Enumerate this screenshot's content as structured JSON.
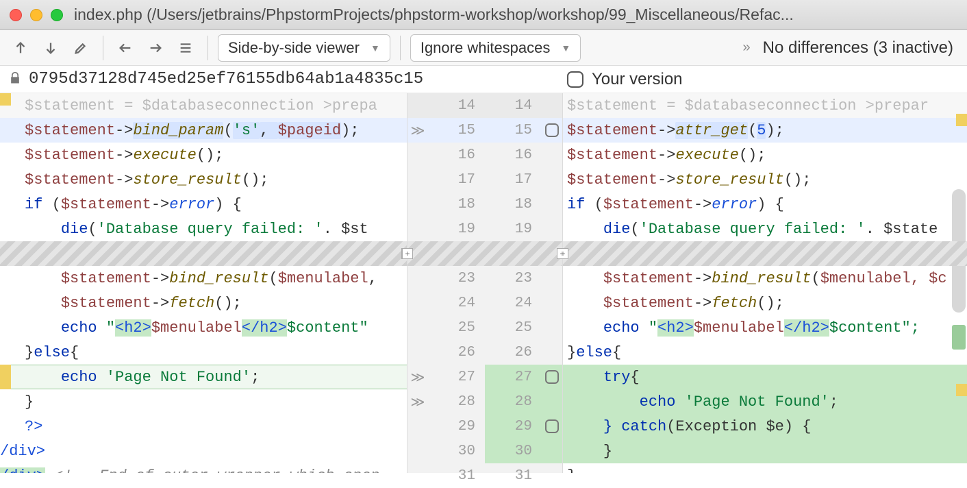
{
  "title": "index.php (/Users/jetbrains/PhpstormProjects/phpstorm-workshop/workshop/99_Miscellaneous/Refac...",
  "toolbar": {
    "dropdown1": "Side-by-side viewer",
    "dropdown2": "Ignore whitespaces",
    "status": "No differences (3 inactive)"
  },
  "header": {
    "hash": "0795d37128d745ed25ef76155db64ab1a4835c15",
    "right_label": "Your version"
  },
  "gutter": {
    "rows": [
      {
        "l": "14",
        "r": "14",
        "mark": "",
        "check": false,
        "bg": "faded"
      },
      {
        "l": "15",
        "r": "15",
        "mark": "≫",
        "check": true,
        "bg": "blue"
      },
      {
        "l": "16",
        "r": "16",
        "mark": "",
        "check": false,
        "bg": ""
      },
      {
        "l": "17",
        "r": "17",
        "mark": "",
        "check": false,
        "bg": ""
      },
      {
        "l": "18",
        "r": "18",
        "mark": "",
        "check": false,
        "bg": ""
      },
      {
        "l": "19",
        "r": "19",
        "mark": "",
        "check": false,
        "bg": ""
      },
      {
        "l": "fold",
        "r": "fold",
        "mark": "",
        "check": false,
        "bg": ""
      },
      {
        "l": "23",
        "r": "23",
        "mark": "",
        "check": false,
        "bg": ""
      },
      {
        "l": "24",
        "r": "24",
        "mark": "",
        "check": false,
        "bg": ""
      },
      {
        "l": "25",
        "r": "25",
        "mark": "",
        "check": false,
        "bg": ""
      },
      {
        "l": "26",
        "r": "26",
        "mark": "",
        "check": false,
        "bg": ""
      },
      {
        "l": "27",
        "r": "27",
        "mark": "≫",
        "check": true,
        "bg": "green"
      },
      {
        "l": "28",
        "r": "28",
        "mark": "≫",
        "check": false,
        "bg": "green"
      },
      {
        "l": "29",
        "r": "29",
        "mark": "",
        "check": true,
        "bg": "green"
      },
      {
        "l": "30",
        "r": "30",
        "mark": "",
        "check": false,
        "bg": "green"
      },
      {
        "l": "31",
        "r": "31",
        "mark": "",
        "check": false,
        "bg": ""
      }
    ]
  },
  "left_code": {
    "l14": "$statement = $databaseconnection >prepa",
    "l15_var": "$statement",
    "l15_method": "bind_param",
    "l15_arg1": "'s'",
    "l15_arg2": "$pageid",
    "l16_var": "$statement",
    "l16_method": "execute",
    "l17_var": "$statement",
    "l17_method": "store_result",
    "l18_kw": "if",
    "l18_var": "$statement",
    "l18_prop": "error",
    "l19_die": "die",
    "l19_str": "'Database query failed: '",
    "l19_tail": " . $st",
    "l23_var": "$statement",
    "l23_method": "bind_result",
    "l23_arg": "$menulabel",
    "l24_var": "$statement",
    "l24_method": "fetch",
    "l25_echo": "echo",
    "l25_q1": "\"",
    "l25_h2o": "<h2>",
    "l25_v": "$menulabel",
    "l25_h2c": "</h2>",
    "l25_rest": " $content\"",
    "l26": "} else {",
    "l27_echo": "echo",
    "l27_str": "'Page Not Found'",
    "l28": "}",
    "l29": "?>",
    "l30": "/div>",
    "l31_tag": "/div>",
    "l31_comment": "<!-- End of outer-wrapper which open"
  },
  "right_code": {
    "r14": "$statement = $databaseconnection >prepar",
    "r15_var": "$statement",
    "r15_method": "attr_get",
    "r15_arg": "5",
    "r16_var": "$statement",
    "r16_method": "execute",
    "r17_var": "$statement",
    "r17_method": "store_result",
    "r18_kw": "if",
    "r18_var": "$statement",
    "r18_prop": "error",
    "r19_die": "die",
    "r19_str": "'Database query failed: '",
    "r19_tail": " . $state",
    "r23_var": "$statement",
    "r23_method": "bind_result",
    "r23_arg": "$menulabel, $c",
    "r24_var": "$statement",
    "r24_method": "fetch",
    "r25_echo": "echo",
    "r25_q1": "\"",
    "r25_h2o": "<h2>",
    "r25_v": "$menulabel",
    "r25_h2c": "</h2>",
    "r25_rest": " $content\";",
    "r26": "} else {",
    "r27_try": "try",
    "r28_echo": "echo",
    "r28_str": "'Page Not Found'",
    "r29_catch": "} catch",
    "r29_rest": " (Exception $e) {",
    "r30": "}",
    "r31": "}"
  }
}
